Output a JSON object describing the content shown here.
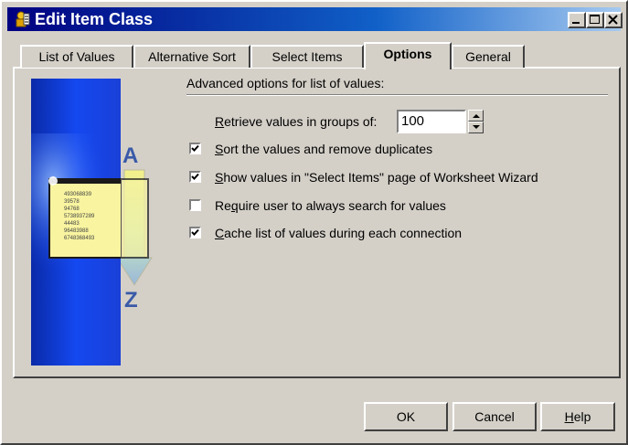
{
  "window": {
    "title": "Edit Item Class"
  },
  "tabs": [
    {
      "label": "List of Values",
      "active": false
    },
    {
      "label": "Alternative Sort",
      "active": false
    },
    {
      "label": "Select Items",
      "active": false
    },
    {
      "label": "Options",
      "active": true
    },
    {
      "label": "General",
      "active": false
    }
  ],
  "options": {
    "heading": "Advanced options for list of values:",
    "retrieve": {
      "label_mnemonic": "R",
      "label_rest": "etrieve values in groups of:",
      "value": "100"
    },
    "checkboxes": [
      {
        "mnemonic": "S",
        "rest": "ort the values and remove duplicates",
        "checked": true
      },
      {
        "mnemonic": "S",
        "rest": "how values in \"Select Items\" page of Worksheet Wizard",
        "checked": true
      },
      {
        "pre": "Re",
        "mnemonic": "q",
        "rest": "uire user to always search for values",
        "checked": false
      },
      {
        "mnemonic": "C",
        "rest": "ache list of values during each connection",
        "checked": true
      }
    ]
  },
  "illustration": {
    "letters": [
      "A",
      "Z"
    ],
    "numbers": [
      "493068839",
      "39578",
      "94768",
      "5738937289",
      "44483",
      "96483988",
      "6748368493"
    ]
  },
  "buttons": {
    "ok": "OK",
    "cancel": "Cancel",
    "help_mnemonic": "H",
    "help_rest": "elp"
  },
  "colors": {
    "title_start": "#000080",
    "title_end": "#a6caf0",
    "face": "#d4d0c8"
  }
}
